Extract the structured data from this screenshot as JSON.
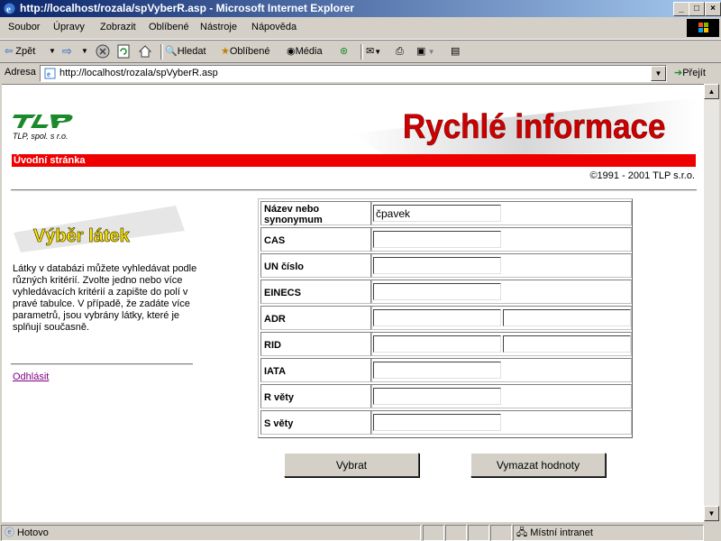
{
  "window": {
    "title": "http://localhost/rozala/spVyberR.asp - Microsoft Internet Explorer"
  },
  "menu": [
    "Soubor",
    "Úpravy",
    "Zobrazit",
    "Oblíbené",
    "Nástroje",
    "Nápověda"
  ],
  "toolbar": {
    "back": "Zpět",
    "search": "Hledat",
    "favorites": "Oblíbené",
    "media": "Média"
  },
  "address": {
    "label": "Adresa",
    "url": "http://localhost/rozala/spVyberR.asp",
    "go": "Přejít"
  },
  "page": {
    "logo_text": "TLP",
    "company": "TLP, spol. s r.o.",
    "banner": "Rychlé informace",
    "nav_label": "Úvodní stránka",
    "copyright": "©1991 - 2001 TLP s.r.o.",
    "section_title": "Výběr látek",
    "description": "Látky v databázi můžete vyhledávat podle různých kritérií. Zvolte jedno nebo více vyhledávacích kritérií a zapište do polí v pravé tabulce. V případě, že zadáte více parametrů, jsou vybrány látky, které je splňují současně.",
    "logout": "Odhlásit",
    "fields": [
      {
        "label": "Název nebo synonymum",
        "value": "čpavek"
      },
      {
        "label": "CAS",
        "value": ""
      },
      {
        "label": "UN číslo",
        "value": ""
      },
      {
        "label": "EINECS",
        "value": ""
      },
      {
        "label": "ADR",
        "value": "",
        "value2": ""
      },
      {
        "label": "RID",
        "value": "",
        "value2": ""
      },
      {
        "label": "IATA",
        "value": ""
      },
      {
        "label": "R věty",
        "value": ""
      },
      {
        "label": "S věty",
        "value": ""
      }
    ],
    "submit": "Vybrat",
    "reset": "Vymazat hodnoty"
  },
  "status": {
    "text": "Hotovo",
    "zone": "Místní intranet"
  },
  "colors": {
    "accent_red": "#e00000",
    "banner_red": "#cc0000",
    "title_blue": "#0a246a",
    "logo_green": "#1a8a2a",
    "section_yellow": "#ffee00"
  }
}
